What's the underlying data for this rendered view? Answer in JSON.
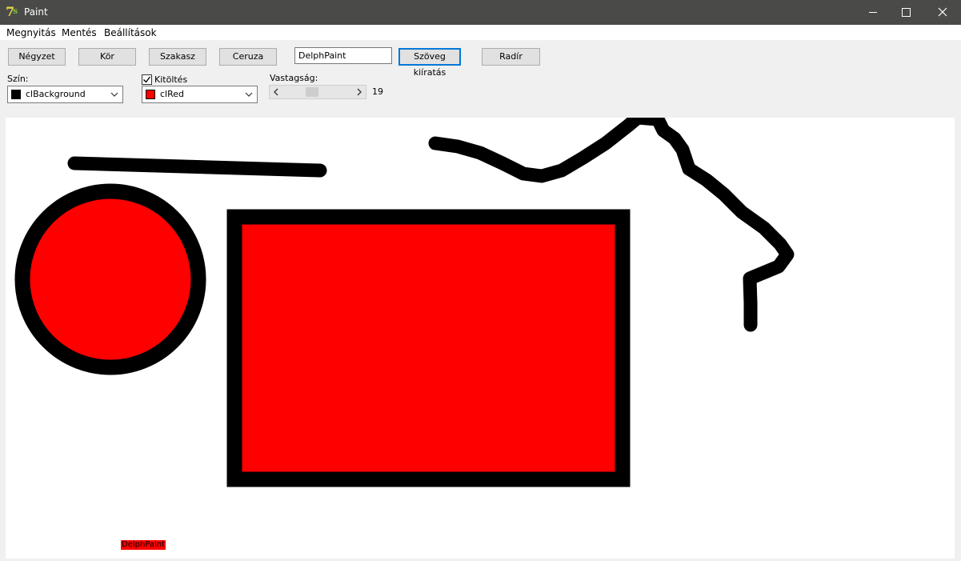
{
  "window": {
    "title": "Paint"
  },
  "menu": {
    "open": "Megnyitás",
    "save": "Mentés",
    "settings": "Beállítások"
  },
  "toolbar": {
    "square": "Négyzet",
    "circle": "Kör",
    "line": "Szakasz",
    "pencil": "Ceruza",
    "text_value": "DelphPaint",
    "write_text": "Szöveg kiíratás",
    "eraser": "Radír"
  },
  "color": {
    "label": "Szín:",
    "value": "clBackground",
    "swatch": "#000000"
  },
  "fill": {
    "label": "Kitöltés",
    "checked": true,
    "value": "clRed",
    "swatch": "#ff0000"
  },
  "thickness": {
    "label": "Vastagság:",
    "value": "19",
    "fraction": 0.19
  },
  "canvas": {
    "text_label": "DelphPaint",
    "stroke_color": "#000000",
    "fill_color": "#ff0000"
  },
  "icons": [
    "app-icon",
    "minimize-icon",
    "maximize-icon",
    "close-icon",
    "chevron-down-icon",
    "check-icon",
    "chevron-left-icon",
    "chevron-right-icon"
  ]
}
